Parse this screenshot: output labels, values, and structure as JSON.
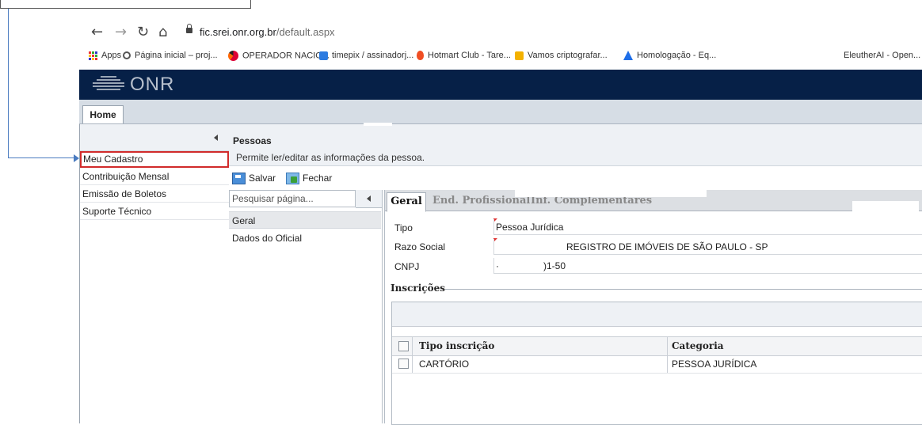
{
  "browser": {
    "url_host": "fic.srei.onr.org.br",
    "url_path": "/default.aspx",
    "bookmarks": [
      {
        "label": "Apps",
        "icon": "apps-grid-icon"
      },
      {
        "label": "Página inicial – proj...",
        "icon": "gear-icon"
      },
      {
        "label": "OPERADOR NACIO...",
        "icon": "swirl-logo-icon"
      },
      {
        "label": "timepix / assinadorj...",
        "icon": "blue-square-icon"
      },
      {
        "label": "Hotmart Club - Tare...",
        "icon": "flame-icon"
      },
      {
        "label": "Vamos criptografar...",
        "icon": "letsencrypt-icon"
      },
      {
        "label": "Homologação - Eq...",
        "icon": "atlassian-icon"
      },
      {
        "label": "EleutherAI - Open...",
        "icon": "none"
      }
    ]
  },
  "app": {
    "logo_text": "ONR",
    "tab": "Home"
  },
  "sidebar": {
    "items": [
      {
        "label": "Meu Cadastro",
        "selected": true
      },
      {
        "label": "Contribuição Mensal"
      },
      {
        "label": "Emissão de Boletos"
      },
      {
        "label": "Suporte Técnico"
      }
    ]
  },
  "main": {
    "title": "Pessoas",
    "description": "Permite ler/editar as informações da pessoa.",
    "toolbar": {
      "save_label": "Salvar",
      "close_label": "Fechar"
    },
    "page_search_placeholder": "Pesquisar página...",
    "page_nav": [
      "Geral",
      "Dados do Oficial"
    ],
    "form_tabs": [
      "Geral",
      "End. Profissional",
      "Inf. Complementares"
    ],
    "fields": {
      "tipo_label": "Tipo",
      "tipo_value": "Pessoa Jurídica",
      "razao_label": "Razo Social",
      "razao_value": "REGISTRO DE IMÓVEIS DE SÃO PAULO - SP",
      "cnpj_label": "CNPJ",
      "cnpj_value_prefix": "·",
      "cnpj_value_suffix": ")1-50"
    },
    "inscricoes": {
      "legend": "Inscrições",
      "columns": [
        "Tipo inscrição",
        "Categoria"
      ],
      "rows": [
        {
          "tipo": "CARTÓRIO",
          "categoria": "PESSOA JURÍDICA"
        }
      ]
    }
  },
  "colors": {
    "header_bg": "#062047",
    "highlight_border": "#d12b2b",
    "callout_line": "#4a7bc0"
  }
}
